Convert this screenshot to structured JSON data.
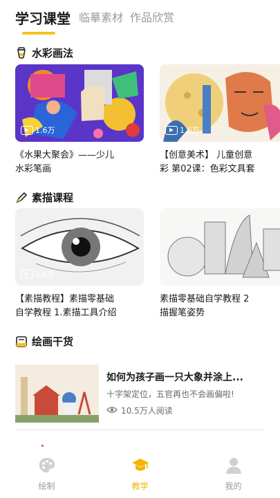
{
  "tabs": [
    {
      "label": "学习课堂",
      "active": true
    },
    {
      "label": "临摹素材",
      "active": false
    },
    {
      "label": "作品欣赏",
      "active": false
    }
  ],
  "sections": [
    {
      "label": "水彩画法",
      "icon": "paint-tube-icon",
      "cards": [
        {
          "title": "《水果大聚会》——少儿\n水彩笔画",
          "views": "1.6万"
        },
        {
          "title": "【创意美术】 儿童创意\n彩 第02课：色彩文具套",
          "views": "1.6万"
        }
      ]
    },
    {
      "label": "素描课程",
      "icon": "pencil-icon",
      "cards": [
        {
          "title": "【素描教程】素描零基础\n自学教程 1.素描工具介绍",
          "views": "1.6万"
        },
        {
          "title": "素描零基础自学教程 2\n描握笔姿势",
          "views": ""
        }
      ]
    },
    {
      "label": "绘画干货",
      "icon": "notebook-icon",
      "article": {
        "title": "如何为孩子画一只大象并涂上...",
        "subtitle": "十字架定位，五官再也不会画偏啦!",
        "reads": "10.5万人阅读"
      }
    }
  ],
  "bottom_nav": [
    {
      "label": "绘制",
      "icon": "palette-icon",
      "active": false
    },
    {
      "label": "教学",
      "icon": "graduation-cap-icon",
      "active": true
    },
    {
      "label": "我的",
      "icon": "user-icon",
      "active": false
    }
  ],
  "colors": {
    "accent": "#f5c21b",
    "active_nav": "#f5b400",
    "muted": "#9a9a9a"
  }
}
